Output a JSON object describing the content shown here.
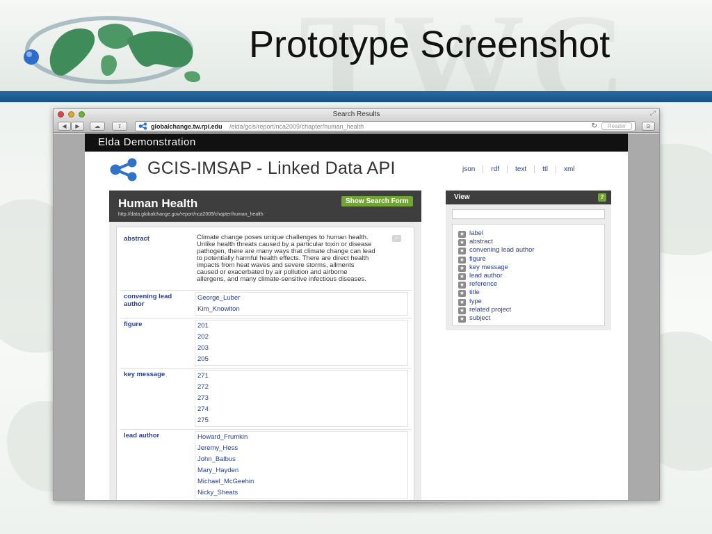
{
  "slide": {
    "title": "Prototype Screenshot",
    "watermark": "TWC"
  },
  "browser": {
    "window_title": "Search Results",
    "address_host": "globalchange.tw.rpi.edu",
    "address_path": "/elda/gcis/report/nca2009/chapter/human_health",
    "reader_label": "Reader"
  },
  "page": {
    "banner": "Elda Demonstration",
    "api_title": "GCIS-IMSAP - Linked Data API",
    "formats": [
      "json",
      "rdf",
      "text",
      "ttl",
      "xml"
    ]
  },
  "resource": {
    "title": "Human Health",
    "uri": "http://data.globalchange.gov/report/nca2009/chapter/human_health",
    "show_search_label": "Show Search Form",
    "abstract_label": "abstract",
    "abstract": "Climate change poses unique challenges to human health. Unlike health threats caused by a particular toxin or disease pathogen, there are many ways that climate change can lead to potentially harmful health effects. There are direct health impacts from heat waves and severe storms, ailments caused or exacerbated by air pollution and airborne allergens, and many climate-sensitive infectious diseases.",
    "properties": [
      {
        "name": "convening lead author",
        "values": [
          "George_Luber",
          "Kim_Knowlton"
        ]
      },
      {
        "name": "figure",
        "values": [
          "201",
          "202",
          "203",
          "205"
        ]
      },
      {
        "name": "key message",
        "values": [
          "271",
          "272",
          "273",
          "274",
          "275"
        ]
      },
      {
        "name": "lead author",
        "values": [
          "Howard_Frumkin",
          "Jeremy_Hess",
          "John_Balbus",
          "Mary_Hayden",
          "Michael_McGeehin",
          "Nicky_Sheats"
        ]
      }
    ]
  },
  "view": {
    "title": "View",
    "help": "?",
    "items": [
      "label",
      "abstract",
      "convening lead author",
      "figure",
      "key message",
      "lead author",
      "reference",
      "title",
      "type",
      "related project",
      "subject"
    ]
  },
  "colors": {
    "link": "#2a3f8a",
    "accent_green": "#73a535",
    "header_dark": "#3e3e3e",
    "slide_bar": "#1f5f96"
  }
}
